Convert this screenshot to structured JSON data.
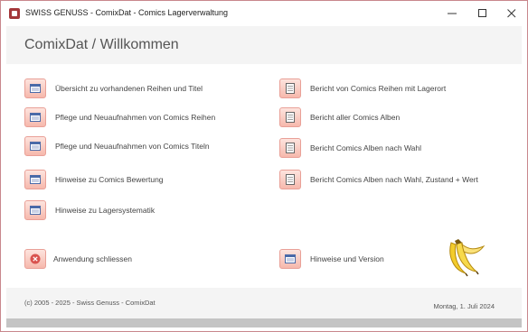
{
  "window": {
    "title": "SWISS GENUSS - ComixDat - Comics Lagerverwaltung"
  },
  "header": {
    "title": "ComixDat / Willkommen"
  },
  "buttons_left": [
    {
      "label": "Übersicht zu vorhandenen Reihen und Titel",
      "icon": "form-icon"
    },
    {
      "label": "Pflege und Neuaufnahmen von Comics Reihen",
      "icon": "form-icon"
    },
    {
      "label": "Pflege und Neuaufnahmen von Comics Titeln",
      "icon": "form-icon"
    },
    {
      "label": "Hinweise zu Comics Bewertung",
      "icon": "form-icon"
    },
    {
      "label": "Hinweise zu Lagersystematik",
      "icon": "form-icon"
    }
  ],
  "buttons_right": [
    {
      "label": "Bericht von Comics Reihen mit Lagerort",
      "icon": "report-icon"
    },
    {
      "label": "Bericht aller Comics Alben",
      "icon": "report-icon"
    },
    {
      "label": "Bericht Comics Alben nach Wahl",
      "icon": "report-icon"
    },
    {
      "label": "Bericht Comics Alben nach Wahl, Zustand + Wert",
      "icon": "report-icon"
    }
  ],
  "actions": {
    "close_app": "Anwendung schliessen",
    "info_version": "Hinweise und Version"
  },
  "footer": {
    "copyright": "(c) 2005 - 2025 - Swiss Genuss - ComixDat",
    "date": "Montag, 1. Juli 2024"
  },
  "colors": {
    "accent": "#a4373a",
    "button_fill": "#f6b8ac",
    "button_border": "#e9a097",
    "close_icon": "#d9534f"
  }
}
